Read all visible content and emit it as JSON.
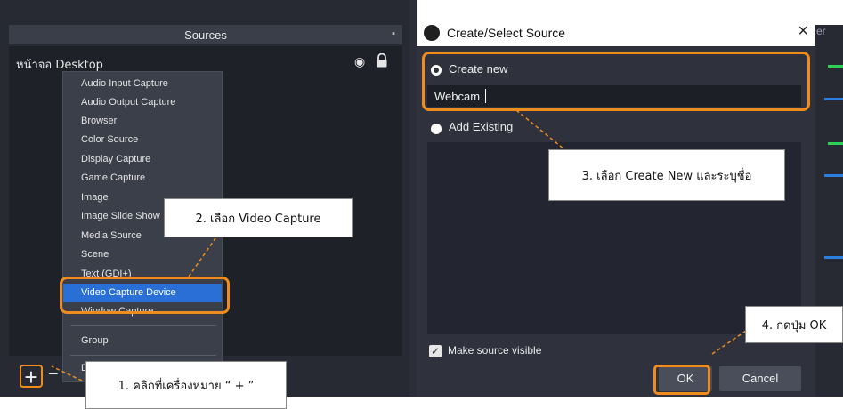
{
  "sources_dock": {
    "title": "Sources",
    "source_item": "หน้าจอ Desktop",
    "context_menu": {
      "items": [
        "Audio Input Capture",
        "Audio Output Capture",
        "Browser",
        "Color Source",
        "Display Capture",
        "Game Capture",
        "Image",
        "Image Slide Show",
        "Media Source",
        "Scene",
        "Text (GDI+)",
        "Video Capture Device",
        "Window Capture"
      ],
      "selected": "Video Capture Device",
      "group_label": "Group"
    },
    "add_label": "+",
    "remove_label": "−"
  },
  "right_strip_text": "er",
  "dialog": {
    "title": "Create/Select Source",
    "close_label": "×",
    "create_new_label": "Create new",
    "name_value": "Webcam",
    "add_existing_label": "Add Existing",
    "make_visible_label": "Make source visible",
    "make_visible_checked": true,
    "ok_label": "OK",
    "cancel_label": "Cancel"
  },
  "annotations": {
    "step1": "1. คลิกที่เครื่องหมาย “ + ”",
    "step2": "2. เลือก Video Capture",
    "step3": "3. เลือก Create New และระบุชื่อ",
    "step4": "4. กดปุ่ม OK"
  },
  "colors": {
    "highlight": "#f08c1e",
    "selected_item": "#2a6fd6",
    "dock_bg": "#272a33",
    "dialog_bg": "#2f323c"
  }
}
